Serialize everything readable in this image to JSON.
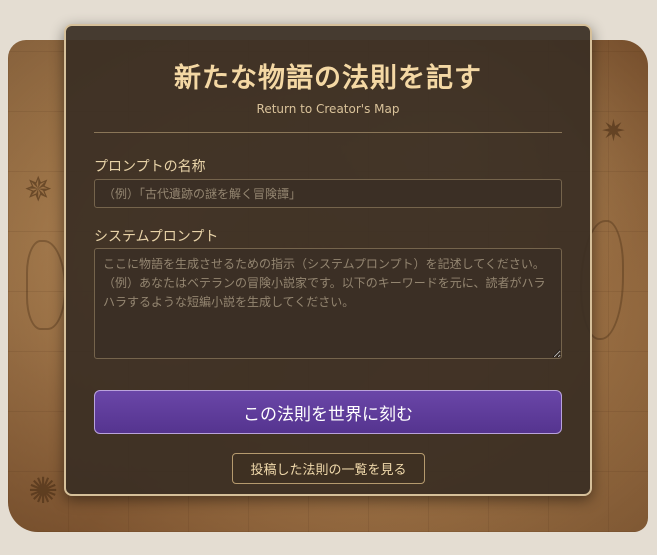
{
  "page": {
    "title": "新たな物語の法則を記す",
    "return_link": "Return to Creator's Map"
  },
  "form": {
    "name_label": "プロンプトの名称",
    "name_placeholder": "（例）「古代遺跡の謎を解く冒険譚」",
    "prompt_label": "システムプロンプト",
    "prompt_placeholder": "ここに物語を生成させるための指示（システムプロンプト）を記述してください。\n（例）あなたはベテランの冒険小説家です。以下のキーワードを元に、読者がハラハラするような短編小説を生成してください。"
  },
  "actions": {
    "submit_label": "この法則を世界に刻む",
    "list_label": "投稿した法則の一覧を見る"
  },
  "colors": {
    "title": "#f4d8a4",
    "panel_bg": "#3a2e24",
    "submit_bg": "#5b3a99",
    "border_accent": "#d6c09a"
  },
  "icons": [
    "compass-rose-icon"
  ]
}
